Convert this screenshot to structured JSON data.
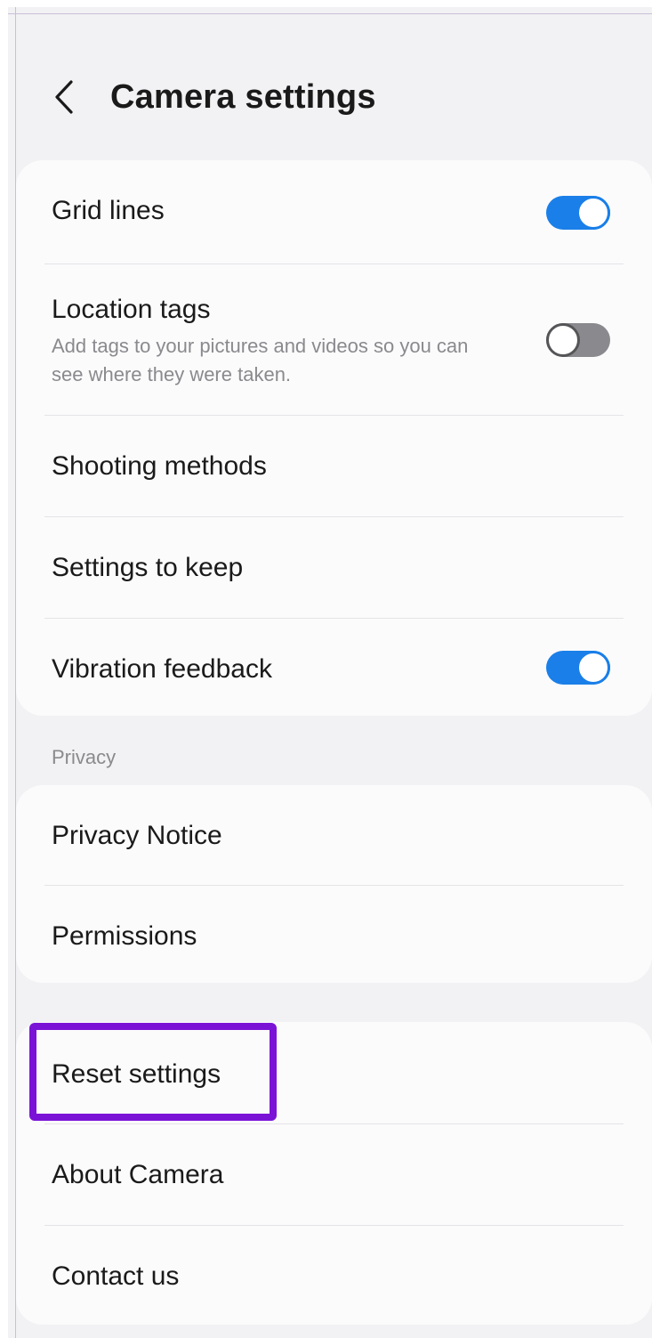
{
  "header": {
    "title": "Camera settings",
    "back_icon": "chevron-left-icon"
  },
  "general": {
    "grid_lines": {
      "label": "Grid lines",
      "enabled": true
    },
    "location_tags": {
      "label": "Location tags",
      "description": "Add tags to your pictures and videos so you can see where they were taken.",
      "enabled": false
    },
    "shooting_methods": {
      "label": "Shooting methods"
    },
    "settings_to_keep": {
      "label": "Settings to keep"
    },
    "vibration_feedback": {
      "label": "Vibration feedback",
      "enabled": true
    }
  },
  "privacy": {
    "section_label": "Privacy",
    "privacy_notice": {
      "label": "Privacy Notice"
    },
    "permissions": {
      "label": "Permissions"
    }
  },
  "other": {
    "reset_settings": {
      "label": "Reset settings",
      "highlighted": true
    },
    "about_camera": {
      "label": "About Camera"
    },
    "contact_us": {
      "label": "Contact us"
    }
  },
  "colors": {
    "background": "#f2f2f4",
    "card": "#fbfbfc",
    "toggle_on": "#1a7fe8",
    "toggle_off": "#8a8a8e",
    "highlight": "#7b13d6",
    "text_primary": "#1a1a1a",
    "text_secondary": "#8a8a8e"
  }
}
